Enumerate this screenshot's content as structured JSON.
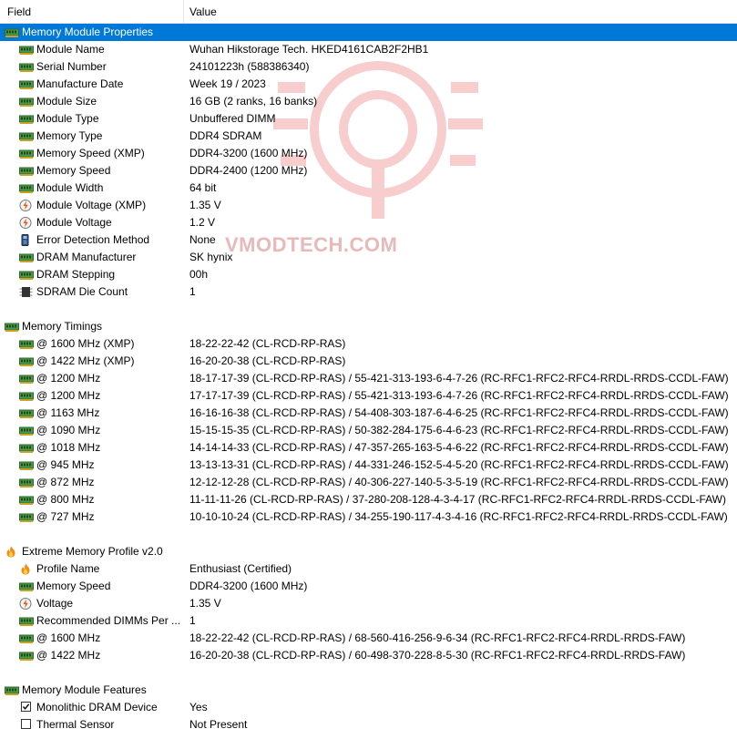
{
  "header": {
    "field": "Field",
    "value": "Value"
  },
  "watermark": "VMODTECH.COM",
  "rows": [
    {
      "level": 0,
      "icon": "memory-module-icon",
      "field": "Memory Module Properties",
      "value": "",
      "selected": true
    },
    {
      "level": 1,
      "icon": "memory-module-icon",
      "field": "Module Name",
      "value": "Wuhan Hikstorage Tech. HKED4161CAB2F2HB1"
    },
    {
      "level": 1,
      "icon": "memory-module-icon",
      "field": "Serial Number",
      "value": "24101223h (588386340)"
    },
    {
      "level": 1,
      "icon": "memory-module-icon",
      "field": "Manufacture Date",
      "value": "Week 19 / 2023"
    },
    {
      "level": 1,
      "icon": "memory-module-icon",
      "field": "Module Size",
      "value": "16 GB (2 ranks, 16 banks)"
    },
    {
      "level": 1,
      "icon": "memory-module-icon",
      "field": "Module Type",
      "value": "Unbuffered DIMM"
    },
    {
      "level": 1,
      "icon": "memory-module-icon",
      "field": "Memory Type",
      "value": "DDR4 SDRAM"
    },
    {
      "level": 1,
      "icon": "memory-module-icon",
      "field": "Memory Speed (XMP)",
      "value": "DDR4-3200 (1600 MHz)"
    },
    {
      "level": 1,
      "icon": "memory-module-icon",
      "field": "Memory Speed",
      "value": "DDR4-2400 (1200 MHz)"
    },
    {
      "level": 1,
      "icon": "memory-module-icon",
      "field": "Module Width",
      "value": "64 bit"
    },
    {
      "level": 1,
      "icon": "voltage-icon",
      "field": "Module Voltage (XMP)",
      "value": "1.35 V"
    },
    {
      "level": 1,
      "icon": "voltage-icon",
      "field": "Module Voltage",
      "value": "1.2 V"
    },
    {
      "level": 1,
      "icon": "error-detection-icon",
      "field": "Error Detection Method",
      "value": "None"
    },
    {
      "level": 1,
      "icon": "memory-module-icon",
      "field": "DRAM Manufacturer",
      "value": "SK hynix"
    },
    {
      "level": 1,
      "icon": "memory-module-icon",
      "field": "DRAM Stepping",
      "value": "00h"
    },
    {
      "level": 1,
      "icon": "chip-icon",
      "field": "SDRAM Die Count",
      "value": "1"
    },
    {
      "blank": true
    },
    {
      "level": 0,
      "icon": "memory-module-icon",
      "field": "Memory Timings",
      "value": ""
    },
    {
      "level": 1,
      "icon": "memory-module-icon",
      "field": "@ 1600 MHz (XMP)",
      "value": "18-22-22-42  (CL-RCD-RP-RAS)"
    },
    {
      "level": 1,
      "icon": "memory-module-icon",
      "field": "@ 1422 MHz (XMP)",
      "value": "16-20-20-38  (CL-RCD-RP-RAS)"
    },
    {
      "level": 1,
      "icon": "memory-module-icon",
      "field": "@ 1200 MHz",
      "value": "18-17-17-39  (CL-RCD-RP-RAS) / 55-421-313-193-6-4-7-26  (RC-RFC1-RFC2-RFC4-RRDL-RRDS-CCDL-FAW)"
    },
    {
      "level": 1,
      "icon": "memory-module-icon",
      "field": "@ 1200 MHz",
      "value": "17-17-17-39  (CL-RCD-RP-RAS) / 55-421-313-193-6-4-7-26  (RC-RFC1-RFC2-RFC4-RRDL-RRDS-CCDL-FAW)"
    },
    {
      "level": 1,
      "icon": "memory-module-icon",
      "field": "@ 1163 MHz",
      "value": "16-16-16-38  (CL-RCD-RP-RAS) / 54-408-303-187-6-4-6-25  (RC-RFC1-RFC2-RFC4-RRDL-RRDS-CCDL-FAW)"
    },
    {
      "level": 1,
      "icon": "memory-module-icon",
      "field": "@ 1090 MHz",
      "value": "15-15-15-35  (CL-RCD-RP-RAS) / 50-382-284-175-6-4-6-23  (RC-RFC1-RFC2-RFC4-RRDL-RRDS-CCDL-FAW)"
    },
    {
      "level": 1,
      "icon": "memory-module-icon",
      "field": "@ 1018 MHz",
      "value": "14-14-14-33  (CL-RCD-RP-RAS) / 47-357-265-163-5-4-6-22  (RC-RFC1-RFC2-RFC4-RRDL-RRDS-CCDL-FAW)"
    },
    {
      "level": 1,
      "icon": "memory-module-icon",
      "field": "@ 945 MHz",
      "value": "13-13-13-31  (CL-RCD-RP-RAS) / 44-331-246-152-5-4-5-20  (RC-RFC1-RFC2-RFC4-RRDL-RRDS-CCDL-FAW)"
    },
    {
      "level": 1,
      "icon": "memory-module-icon",
      "field": "@ 872 MHz",
      "value": "12-12-12-28  (CL-RCD-RP-RAS) / 40-306-227-140-5-3-5-19  (RC-RFC1-RFC2-RFC4-RRDL-RRDS-CCDL-FAW)"
    },
    {
      "level": 1,
      "icon": "memory-module-icon",
      "field": "@ 800 MHz",
      "value": "11-11-11-26  (CL-RCD-RP-RAS) / 37-280-208-128-4-3-4-17  (RC-RFC1-RFC2-RFC4-RRDL-RRDS-CCDL-FAW)"
    },
    {
      "level": 1,
      "icon": "memory-module-icon",
      "field": "@ 727 MHz",
      "value": "10-10-10-24  (CL-RCD-RP-RAS) / 34-255-190-117-4-3-4-16  (RC-RFC1-RFC2-RFC4-RRDL-RRDS-CCDL-FAW)"
    },
    {
      "blank": true
    },
    {
      "level": 0,
      "icon": "flame-icon",
      "field": "Extreme Memory Profile v2.0",
      "value": ""
    },
    {
      "level": 1,
      "icon": "flame-icon",
      "field": "Profile Name",
      "value": "Enthusiast (Certified)"
    },
    {
      "level": 1,
      "icon": "memory-module-icon",
      "field": "Memory Speed",
      "value": "DDR4-3200 (1600 MHz)"
    },
    {
      "level": 1,
      "icon": "voltage-icon",
      "field": "Voltage",
      "value": "1.35 V"
    },
    {
      "level": 1,
      "icon": "memory-module-icon",
      "field": "Recommended DIMMs Per ...",
      "value": "1"
    },
    {
      "level": 1,
      "icon": "memory-module-icon",
      "field": "@ 1600 MHz",
      "value": "18-22-22-42  (CL-RCD-RP-RAS) / 68-560-416-256-9-6-34  (RC-RFC1-RFC2-RFC4-RRDL-RRDS-FAW)"
    },
    {
      "level": 1,
      "icon": "memory-module-icon",
      "field": "@ 1422 MHz",
      "value": "16-20-20-38  (CL-RCD-RP-RAS) / 60-498-370-228-8-5-30  (RC-RFC1-RFC2-RFC4-RRDL-RRDS-FAW)"
    },
    {
      "blank": true
    },
    {
      "level": 0,
      "icon": "memory-module-icon",
      "field": "Memory Module Features",
      "value": ""
    },
    {
      "level": 1,
      "icon": "checkbox-checked",
      "field": "Monolithic DRAM Device",
      "value": "Yes"
    },
    {
      "level": 1,
      "icon": "checkbox-unchecked",
      "field": "Thermal Sensor",
      "value": "Not Present"
    }
  ]
}
